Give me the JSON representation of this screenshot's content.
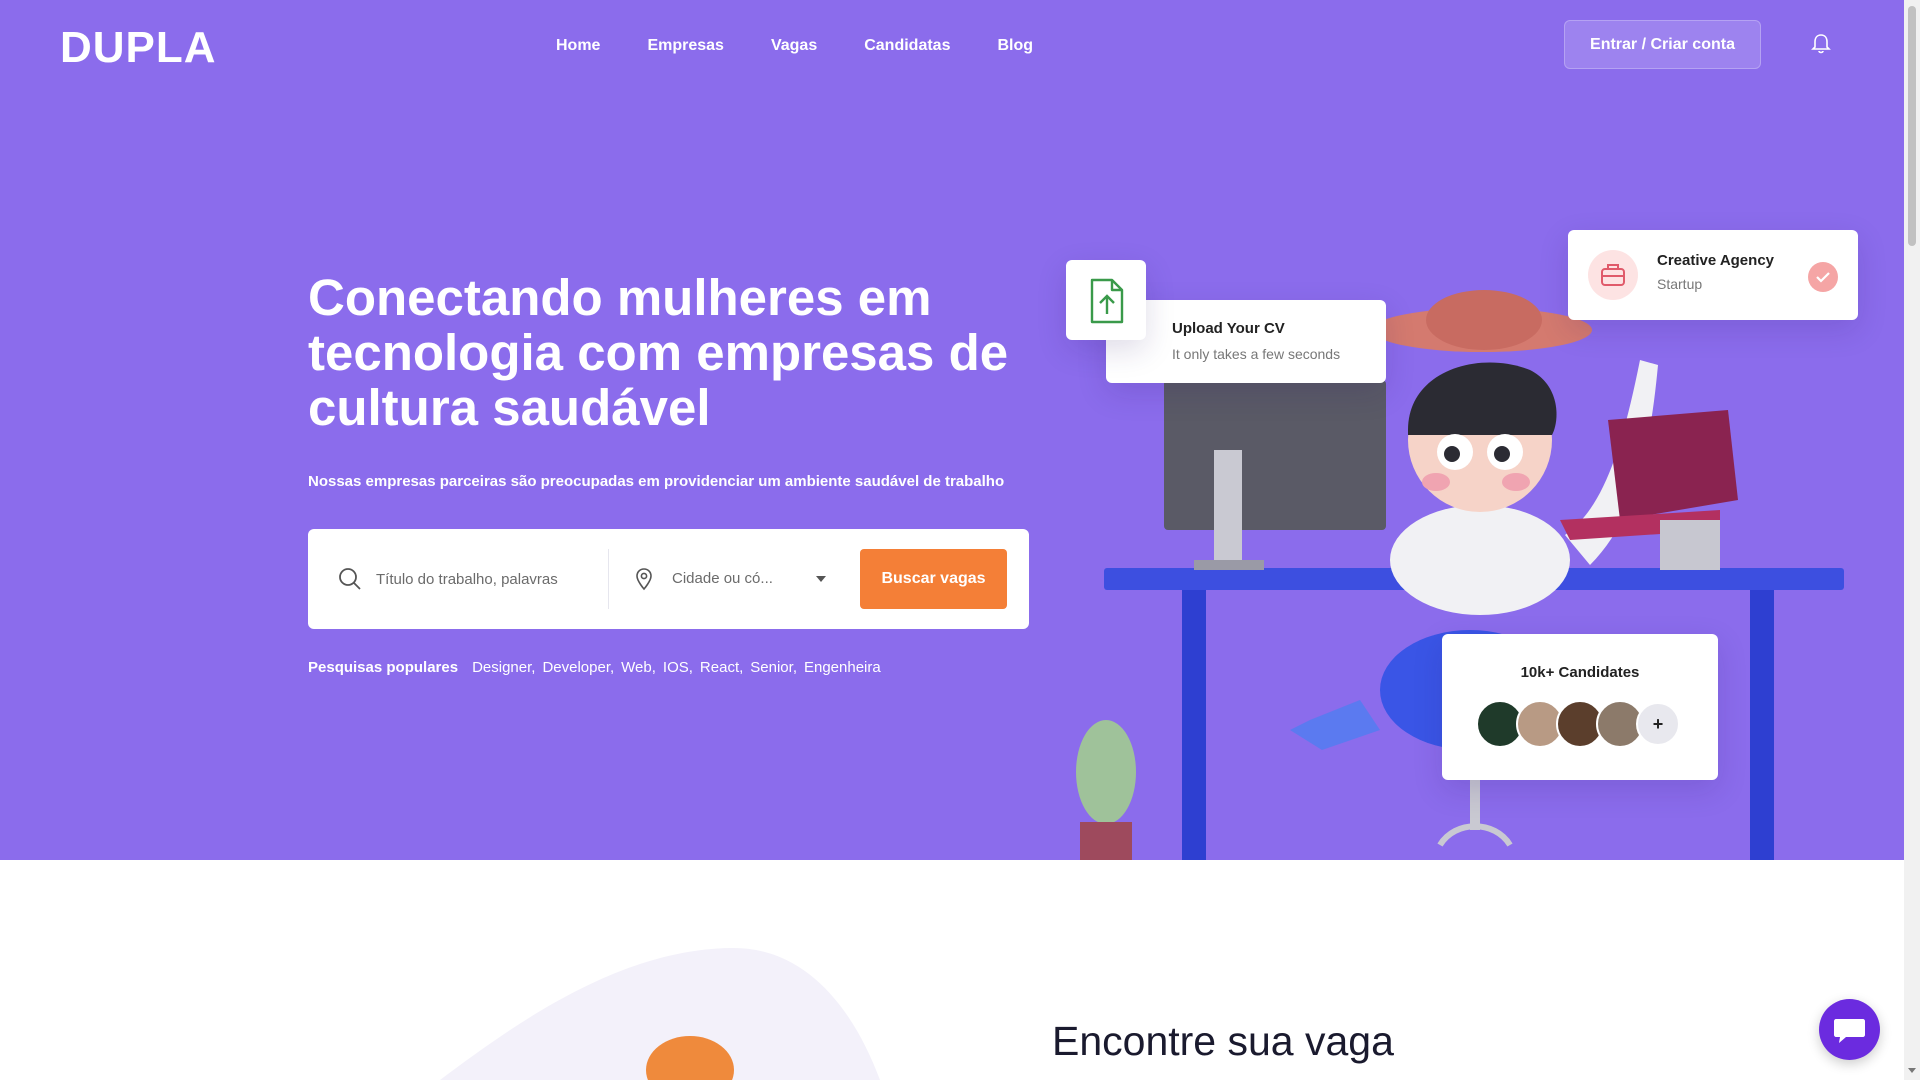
{
  "brand": {
    "logo_text": "DUPLA"
  },
  "nav": {
    "items": [
      "Home",
      "Empresas",
      "Vagas",
      "Candidatas",
      "Blog"
    ],
    "login_label": "Entrar / Criar conta"
  },
  "hero": {
    "headline": "Conectando mulheres em tecnologia com empresas de cultura saudável",
    "subline": "Nossas empresas parceiras são preocupadas em providenciar um ambiente saudável de trabalho",
    "search": {
      "keyword_placeholder": "Título do trabalho, palavras",
      "city_value": "Cidade ou có...",
      "button_label": "Buscar vagas"
    },
    "popular": {
      "label": "Pesquisas populares",
      "tags": [
        "Designer,",
        "Developer,",
        "Web,",
        "IOS,",
        "React,",
        "Senior,",
        "Engenheira"
      ]
    }
  },
  "illustration": {
    "cv_card": {
      "title": "Upload Your CV",
      "subtitle": "It only takes a few seconds"
    },
    "agency_card": {
      "title": "Creative Agency",
      "subtitle": "Startup"
    },
    "candidates_card": {
      "title": "10k+ Candidates",
      "plus": "+"
    }
  },
  "section2": {
    "title": "Encontre sua vaga"
  },
  "colors": {
    "hero_bg": "#8b6cec",
    "accent_orange": "#f47f37",
    "chat_purple": "#6b2bdf"
  },
  "icons": [
    "bell-icon",
    "search-icon",
    "location-pin-icon",
    "caret-down-icon",
    "file-upload-icon",
    "briefcase-icon",
    "check-icon",
    "chat-icon"
  ]
}
